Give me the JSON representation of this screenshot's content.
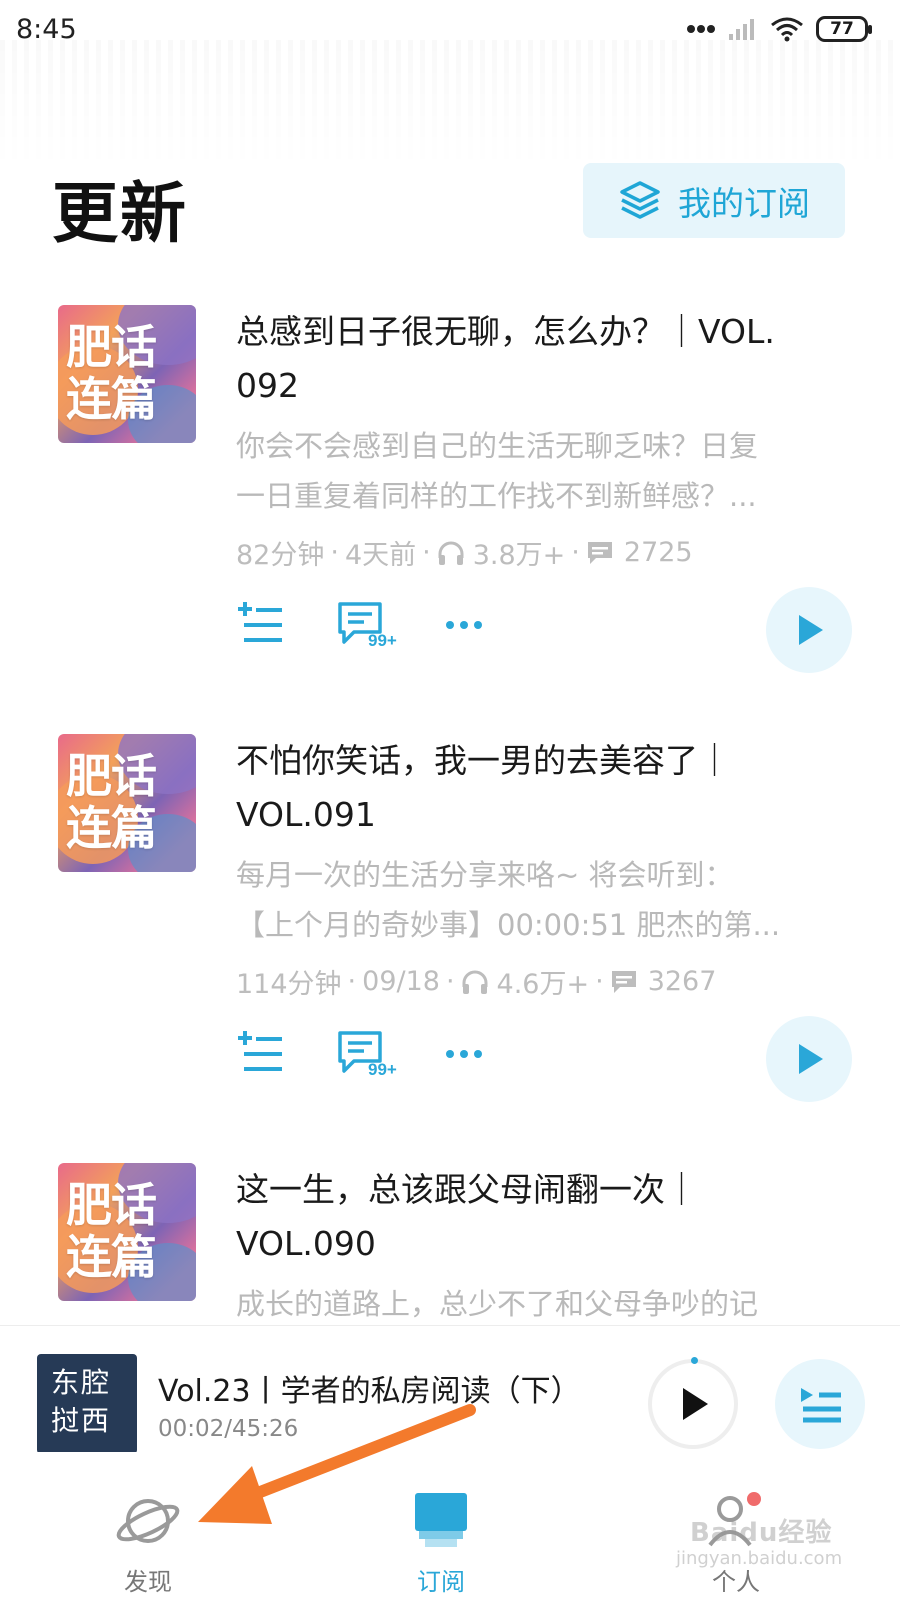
{
  "status_bar": {
    "time": "8:45",
    "battery": "77"
  },
  "header": {
    "title": "更新",
    "subscribe_label": "我的订阅"
  },
  "episodes": [
    {
      "cover_text": [
        "肥话",
        "连篇"
      ],
      "title_lines": [
        "总感到日子很无聊，怎么办？｜VOL.",
        "092"
      ],
      "desc_lines": [
        "你会不会感到自己的生活无聊乏味？日复",
        "一日重复着同样的工作找不到新鲜感？..."
      ],
      "duration": "82分钟",
      "date": "4天前",
      "listens": "3.8万+",
      "comments": "2725",
      "comment_badge": "99+"
    },
    {
      "cover_text": [
        "肥话",
        "连篇"
      ],
      "title_lines": [
        "不怕你笑话，我一男的去美容了｜",
        "VOL.091"
      ],
      "desc_lines": [
        "每月一次的生活分享来咯~ 将会听到：",
        "【上个月的奇妙事】00:00:51 肥杰的第..."
      ],
      "duration": "114分钟",
      "date": "09/18",
      "listens": "4.6万+",
      "comments": "3267",
      "comment_badge": "99+"
    },
    {
      "cover_text": [
        "肥话",
        "连篇"
      ],
      "title_lines": [
        "这一生，总该跟父母闹翻一次｜",
        "VOL.090"
      ],
      "desc_lines": [
        "成长的道路上，总少不了和父母争吵的记"
      ]
    }
  ],
  "mini_player": {
    "cover_text": [
      "东腔",
      "挝西"
    ],
    "title": "Vol.23丨学者的私房阅读（下）",
    "time": "00:02/45:26"
  },
  "tabs": [
    {
      "label": "发现",
      "color": "#777777"
    },
    {
      "label": "订阅",
      "color": "#2aa7d8"
    },
    {
      "label": "个人",
      "color": "#777777"
    }
  ],
  "colors": {
    "accent": "#2aa7d8",
    "accent_bg": "#e7f6fc",
    "annotation_arrow": "#f37a2c"
  },
  "watermark": {
    "brand": "Baidu经验",
    "url": "jingyan.baidu.com"
  }
}
